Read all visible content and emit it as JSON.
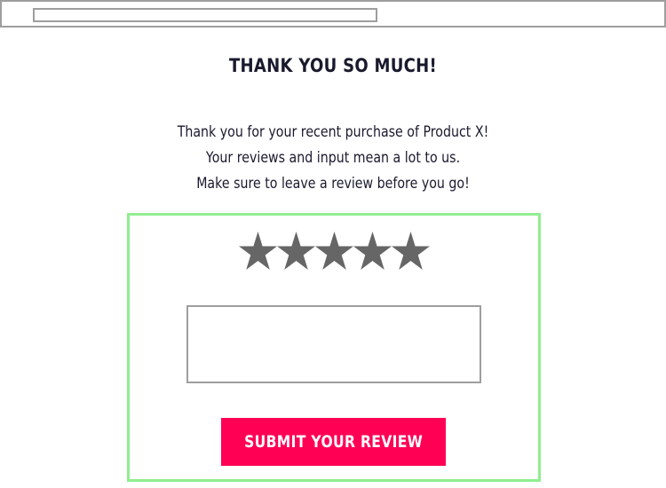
{
  "browser": {
    "url_value": ""
  },
  "header": {
    "title": "THANK YOU SO MUCH!"
  },
  "message": {
    "lines": [
      "Thank you for your recent purchase of Product X!",
      "Your reviews and input mean a lot to us.",
      "Make sure to leave a review before you go!"
    ]
  },
  "review": {
    "rating": 5,
    "max_rating": 5,
    "star_color": "#666666",
    "text_value": "",
    "submit_label": "SUBMIT YOUR REVIEW"
  },
  "colors": {
    "accent": "#ff0055",
    "box_border": "#90ee90",
    "field_border": "#9e9e9e",
    "text": "#1a1a2e"
  },
  "icons": {
    "star": "star-icon"
  }
}
